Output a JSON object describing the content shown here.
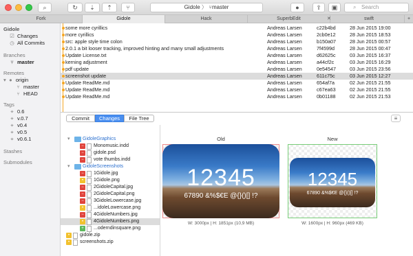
{
  "toolbar": {
    "path_repo": "Gidole",
    "path_sep": "〉",
    "path_branch_icon": "branch-icon",
    "path_branch": "master",
    "search_placeholder": "Search"
  },
  "tabs": [
    {
      "label": "Fork"
    },
    {
      "label": "Gidole"
    },
    {
      "label": "Hack"
    },
    {
      "label": "SuperbEdit"
    },
    {
      "label": "swift"
    }
  ],
  "sidebar": {
    "repo": "Gidole",
    "changes": "Changes",
    "all_commits": "All Commits",
    "branches_h": "Branches",
    "branch": "master",
    "remotes_h": "Remotes",
    "remote": "origin",
    "remote_branch1": "master",
    "remote_branch2": "HEAD",
    "tags_h": "Tags",
    "tags": [
      "0.6",
      "v.0.7",
      "v0.4",
      "v0.5",
      "v0.6.1"
    ],
    "stashes_h": "Stashes",
    "submodules_h": "Submodules"
  },
  "commits": [
    {
      "msg": "some more cyrillics",
      "author": "Andreas Larsen",
      "sha": "c22b4bd",
      "date": "28 Jun 2015 19:00"
    },
    {
      "msg": "more cyrillics",
      "author": "Andreas Larsen",
      "sha": "2cb0e12",
      "date": "28 Jun 2015 18:53"
    },
    {
      "msg": "src: apple style time colon",
      "author": "Andreas Larsen",
      "sha": "b150a07",
      "date": "28 Jun 2015 00:57"
    },
    {
      "msg": "2.0.1 a bit looser tracking, improved hinting and many small adjustments",
      "author": "Andreas Larsen",
      "sha": "7f4599d",
      "date": "28 Jun 2015 00:47"
    },
    {
      "msg": "Update License.txt",
      "author": "Andreas Larsen",
      "sha": "d62625c",
      "date": "03 Jun 2015 16:37"
    },
    {
      "msg": "kerning adjustment",
      "author": "Andreas Larsen",
      "sha": "a44cf2c",
      "date": "03 Jun 2015 16:29"
    },
    {
      "msg": "pdf update",
      "author": "Andreas Larsen",
      "sha": "0e54547",
      "date": "03 Jun 2015 23:56"
    },
    {
      "msg": "screenshot update",
      "author": "Andreas Larsen",
      "sha": "611c75c",
      "date": "03 Jun 2015 12:27"
    },
    {
      "msg": "Update ReadMe.md",
      "author": "Andreas Larsen",
      "sha": "654af7a",
      "date": "02 Jun 2015 21:55"
    },
    {
      "msg": "Update ReadMe.md",
      "author": "Andreas Larsen",
      "sha": "c67ea63",
      "date": "02 Jun 2015 21:55"
    },
    {
      "msg": "Update ReadMe.md",
      "author": "Andreas Larsen",
      "sha": "0b01188",
      "date": "02 Jun 2015 21:53"
    }
  ],
  "view_tabs": {
    "commit": "Commit",
    "changes": "Changes",
    "file_tree": "File Tree"
  },
  "files": [
    {
      "name": "GidoleGraphics",
      "kind": "folder"
    },
    {
      "name": "Monomusic.indd",
      "kind": "file",
      "status": "D"
    },
    {
      "name": "gidole.psd",
      "kind": "file",
      "status": "D"
    },
    {
      "name": "vote thumbs.indd",
      "kind": "file",
      "status": "D"
    },
    {
      "name": "GidoleScreenshots",
      "kind": "folder"
    },
    {
      "name": "1Gidole.jpg",
      "kind": "file",
      "status": "D"
    },
    {
      "name": "1Gidole.png",
      "kind": "file",
      "status": "M"
    },
    {
      "name": "2GidoleCapital.jpg",
      "kind": "file",
      "status": "D"
    },
    {
      "name": "2GidoleCapital.png",
      "kind": "file",
      "status": "D"
    },
    {
      "name": "3GidoleLowercase.jpg",
      "kind": "file",
      "status": "D"
    },
    {
      "name": "...idoleLowercase.png",
      "kind": "file",
      "status": "M"
    },
    {
      "name": "4GidoleNumbers.jpg",
      "kind": "file",
      "status": "D"
    },
    {
      "name": "4GidoleNumbers.png",
      "kind": "file",
      "status": "M"
    },
    {
      "name": "...oderndinsquare.png",
      "kind": "file",
      "status": "A"
    },
    {
      "name": "gidole.zip",
      "kind": "file",
      "status": "M"
    },
    {
      "name": "screenshots.zip",
      "kind": "file",
      "status": "M"
    }
  ],
  "status_colors": {
    "D": "#e0443c",
    "M": "#f2c12e",
    "A": "#5cb85c"
  },
  "accent": "#4a8ff0",
  "compare": {
    "old_label": "Old",
    "new_label": "New",
    "digits": "12345",
    "subline": "67890 &%$€E @{}()[] !?",
    "old_dim": "W: 3000px | H: 1851px (10,9 MB)",
    "new_dim": "W: 1600px | H: 960px (469 KB)"
  }
}
